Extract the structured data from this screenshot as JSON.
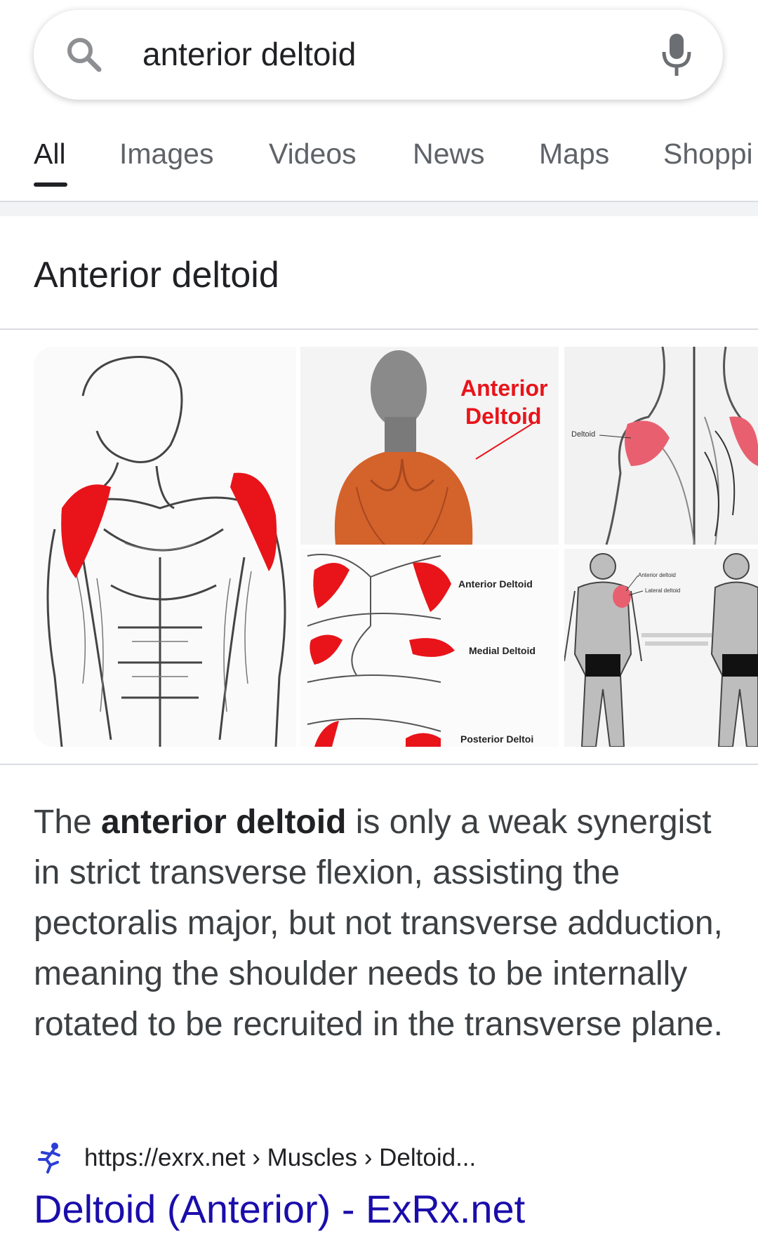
{
  "search": {
    "query": "anterior deltoid"
  },
  "tabs": [
    {
      "label": "All",
      "active": true
    },
    {
      "label": "Images"
    },
    {
      "label": "Videos"
    },
    {
      "label": "News"
    },
    {
      "label": "Maps"
    },
    {
      "label": "Shoppi"
    }
  ],
  "knowledge_panel": {
    "title": "Anterior deltoid",
    "images": [
      {
        "kind": "torso-sketch-highlighted-deltoids"
      },
      {
        "kind": "anatomical-bust",
        "label_line1": "Anterior",
        "label_line2": "Deltoid"
      },
      {
        "kind": "back-view-deltoids",
        "label": "Deltoid"
      },
      {
        "kind": "deltoid-heads",
        "labels": [
          "Anterior Deltoid",
          "Medial Deltoid",
          "Posterior Deltoi"
        ]
      },
      {
        "kind": "bodybuilder-figures",
        "labels": [
          "Anterior deltoid",
          "Lateral deltoid"
        ]
      }
    ],
    "description": {
      "lead": "The ",
      "bold": "anterior deltoid",
      "rest": " is only a weak synergist in strict transverse flexion, assisting the pectoralis major, but not transverse adduction, meaning the shoulder needs to be internally rotated to be recruited in the transverse plane."
    },
    "source": {
      "url": "https://exrx.net › Muscles › Deltoid...",
      "favicon": "running-figure-icon",
      "link_text": "Deltoid (Anterior) - ExRx.net"
    }
  },
  "colors": {
    "link": "#1a0dab",
    "highlight": "#e8141a",
    "muscle": "#d4622b"
  }
}
